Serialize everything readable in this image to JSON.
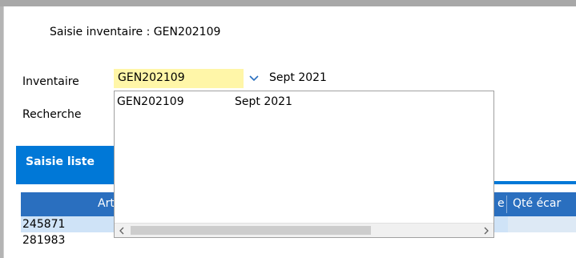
{
  "window": {
    "title": "Saisie inventaire : GEN202109"
  },
  "form": {
    "inventaire_label": "Inventaire",
    "recherche_label": "Recherche",
    "inventaire_value": "GEN202109",
    "inventaire_desc": "Sept 2021"
  },
  "dropdown": {
    "items": [
      {
        "code": "GEN202109",
        "name": "Sept 2021"
      }
    ]
  },
  "tabs": {
    "active": "Saisie liste"
  },
  "grid": {
    "headers": {
      "article": "Artic",
      "e_col": "e",
      "qte_ecart": "Qté écar"
    },
    "rows": [
      {
        "article": "245871",
        "selected": true
      },
      {
        "article": "281983",
        "selected": false
      }
    ]
  },
  "colors": {
    "accent": "#0078d7",
    "combo_highlight": "#fff6a8",
    "grid_header": "#2a6fbf"
  },
  "icons": {
    "combo_arrow": "chevron-down-icon",
    "scroll_left": "chevron-left-icon",
    "scroll_right": "chevron-right-icon"
  }
}
